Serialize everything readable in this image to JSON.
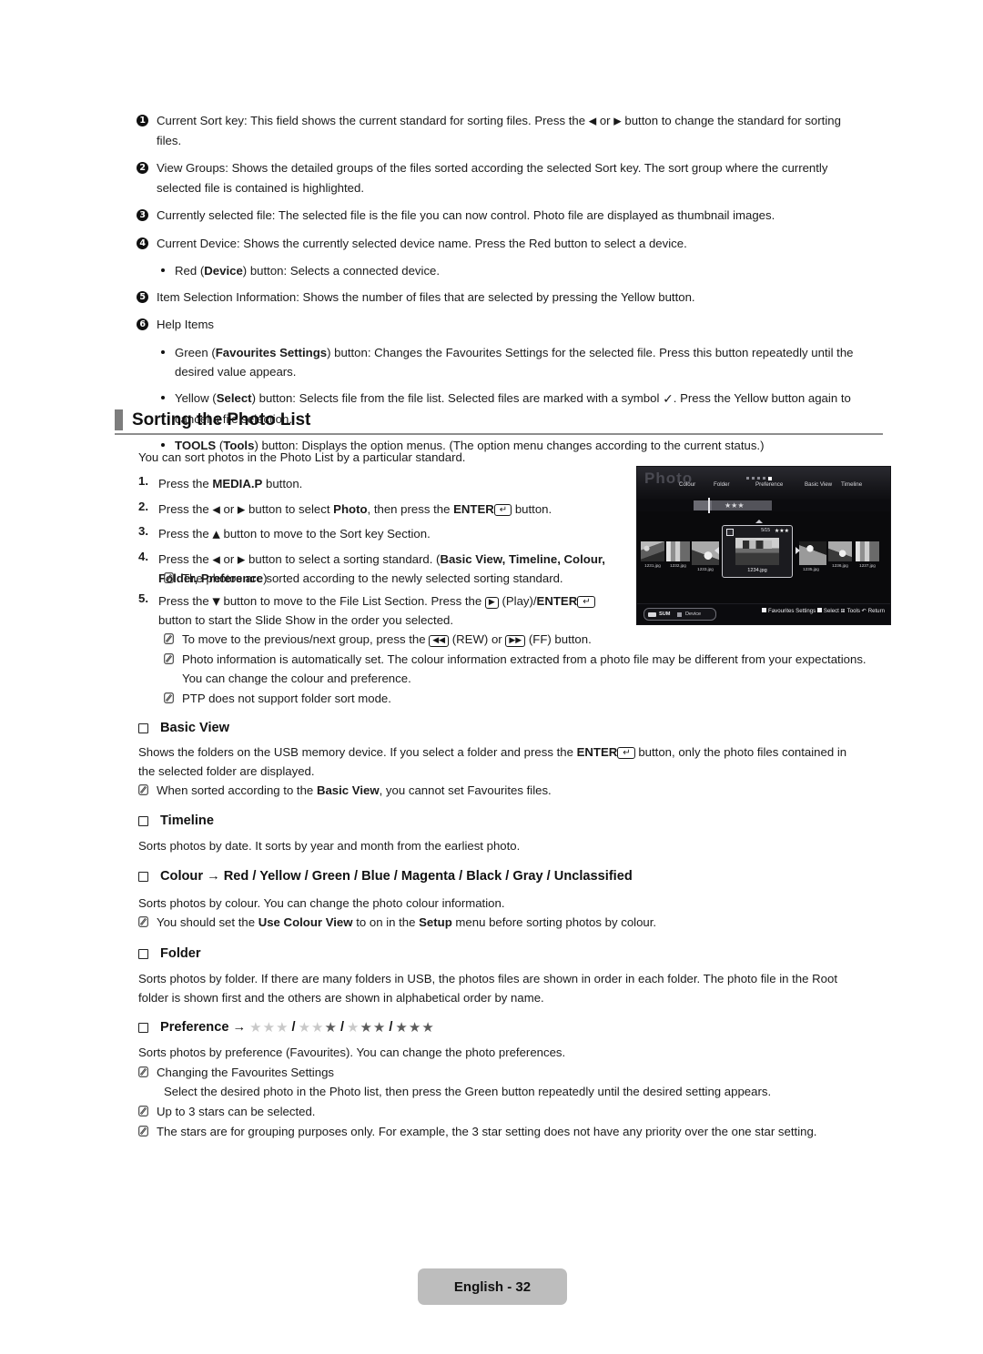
{
  "callouts": [
    {
      "num": "1",
      "glyph": "❶",
      "text_a": "Current Sort key: This field shows the current standard for sorting files. Press the ",
      "text_b": " or ",
      "text_c": " button to change the standard for sorting files."
    },
    {
      "num": "2",
      "glyph": "❷",
      "text": "View Groups:  Shows the detailed groups of the files sorted according the selected Sort key. The sort group where the currently selected file is contained is highlighted."
    },
    {
      "num": "3",
      "glyph": "❸",
      "text": "Currently selected file: The selected file is the file you can now control. Photo file are displayed as thumbnail images."
    },
    {
      "num": "4",
      "glyph": "❹",
      "text": "Current Device: Shows the currently selected device name. Press the Red button to select a device.",
      "bullet_pre": "Red (",
      "bullet_bold": "Device",
      "bullet_post": ") button: Selects a connected device."
    },
    {
      "num": "5",
      "glyph": "❺",
      "text": "Item Selection Information: Shows the number of files that are selected by pressing the Yellow button."
    },
    {
      "num": "6",
      "glyph": "❻",
      "text": "Help Items"
    }
  ],
  "help_bullets": [
    {
      "pre": "Green (",
      "bold": "Favourites Settings",
      "post": ") button: Changes the Favourites Settings for the selected file. Press this button repeatedly until the desired value appears."
    },
    {
      "pre": "Yellow (",
      "bold": "Select",
      "post": ") button: Selects file from the file list. Selected files are marked with a symbol ",
      "post2": ". Press the Yellow button again to cancel a file selection."
    },
    {
      "pre_bold": "TOOLS",
      "pre2": " (",
      "bold": "Tools",
      "post": ") button: Displays the option menus. (The option menu changes according to the current status.)"
    }
  ],
  "section": {
    "title": "Sorting the Photo List",
    "intro": "You can sort photos in the Photo List by a particular standard."
  },
  "steps": [
    {
      "num": "1.",
      "pre": "Press the ",
      "bold": "MEDIA.P",
      "post": " button."
    },
    {
      "num": "2.",
      "pre": "Press the ",
      "mid": " or ",
      "mid2": " button to select ",
      "bold": "Photo",
      "post": ", then press the ",
      "bold2": "ENTER",
      "post2": " button."
    },
    {
      "num": "3.",
      "pre": "Press the ",
      "post": " button to move to the Sort key Section."
    },
    {
      "num": "4.",
      "pre": "Press the ",
      "mid": " or ",
      "mid2": " button to select a sorting standard. (",
      "bold": "Basic View, Timeline, Colour, Folder, Preference",
      "post": ")"
    },
    {
      "num": "5.",
      "pre": "Press the ",
      "mid": " button to move to the File List Section.  Press the ",
      "mid2": " (Play)/",
      "bold": "ENTER",
      "post": " button to start the Slide Show in the order you selected."
    }
  ],
  "step_notes": {
    "after4": "The photos are sorted according to the newly selected sorting standard.",
    "rew_pre": "To move to the previous/next group, press the ",
    "rew_mid": " (REW) or ",
    "rew_post": " (FF) button.",
    "photo_info": "Photo information is automatically set. The colour information extracted from a photo file may be different from your expectations. You can change the colour and preference.",
    "ptp": "PTP does not support folder sort mode."
  },
  "subsections": [
    {
      "title": "Basic View",
      "body_pre": "Shows the folders on the USB memory device. If you select a folder and press the ",
      "body_bold": "ENTER",
      "body_post": " button, only the photo files contained in the selected folder are displayed.",
      "note_pre": "When sorted according to the ",
      "note_bold": "Basic View",
      "note_post": ", you cannot set Favourites files."
    },
    {
      "title": "Timeline",
      "body": "Sorts photos by date. It sorts by year and month from the earliest photo."
    },
    {
      "title": "Colour → Red / Yellow / Green / Blue / Magenta / Black / Gray / Unclassified",
      "body": "Sorts photos by colour. You can change the photo colour information.",
      "note_pre": "You should set the ",
      "note_bold": "Use Colour View",
      "note_mid": " to on in the ",
      "note_bold2": "Setup",
      "note_post": " menu before sorting photos by colour."
    },
    {
      "title": "Folder",
      "body": "Sorts photos by folder. If there are many folders in USB, the photos files are shown in order in each folder. The photo file in the Root folder is shown first and the others are shown in alphabetical order by name."
    },
    {
      "title": "Preference →",
      "body": "Sorts photos by preference (Favourites). You can change the photo preferences.",
      "note1": "Changing the Favourites Settings",
      "note1_sub": "Select the desired photo in the Photo list, then press the Green button repeatedly until the desired setting appears.",
      "note2": "Up to 3 stars can be selected.",
      "note3": "The stars are for grouping purposes only. For example, the 3 star setting does not have any priority over the one star setting."
    }
  ],
  "preference_stars": [
    {
      "on": 0,
      "off": 3
    },
    {
      "on": 1,
      "off": 2
    },
    {
      "on": 2,
      "off": 1
    },
    {
      "on": 3,
      "off": 0
    }
  ],
  "tv_screen": {
    "word": "Photo",
    "menu": [
      "Colour",
      "Folder",
      "Preference",
      "Basic View",
      "Timeline"
    ],
    "group_stars": "★★★",
    "selected_count": "5/15",
    "selected_stars": "★★★",
    "selected_file": "1234.jpg",
    "thumbs": [
      "1231.jpg",
      "1232.jpg",
      "1233.jpg",
      "1235.jpg",
      "1236.jpg",
      "1237.jpg"
    ],
    "device_label": "SUM",
    "device_text": "Device",
    "help": [
      "Favourites Settings",
      "Select",
      "Tools",
      "Return"
    ]
  },
  "footer": {
    "label": "English - 32"
  },
  "colors": {
    "heading_bar": "#7d7d7d",
    "rule": "#8d8d8d",
    "footer_bg": "#bdbdbd",
    "star_on": "#5c5c5c",
    "star_off": "#c9c9c9"
  }
}
